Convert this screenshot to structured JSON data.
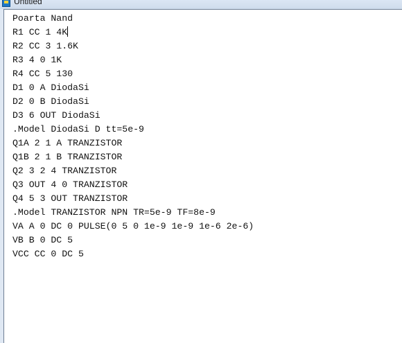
{
  "window": {
    "title": "Untitled"
  },
  "editor": {
    "lines": [
      "Poarta Nand",
      "R1 CC 1 4K",
      "R2 CC 3 1.6K",
      "R3 4 0 1K",
      "R4 CC 5 130",
      "D1 0 A DiodaSi",
      "D2 0 B DiodaSi",
      "D3 6 OUT DiodaSi",
      ".Model DiodaSi D tt=5e-9",
      "Q1A 2 1 A TRANZISTOR",
      "Q1B 2 1 B TRANZISTOR",
      "Q2 3 2 4 TRANZISTOR",
      "Q3 OUT 4 0 TRANZISTOR",
      "Q4 5 3 OUT TRANZISTOR",
      ".Model TRANZISTOR NPN TR=5e-9 TF=8e-9",
      "VA A 0 DC 0 PULSE(0 5 0 1e-9 1e-9 1e-6 2e-6)",
      "VB B 0 DC 5",
      "VCC CC 0 DC 5"
    ]
  },
  "icons": {
    "app": "notepad-app-icon"
  },
  "colors": {
    "titlebar": "#dbe6f4",
    "editor_background": "#ffffff",
    "text": "#111111"
  }
}
